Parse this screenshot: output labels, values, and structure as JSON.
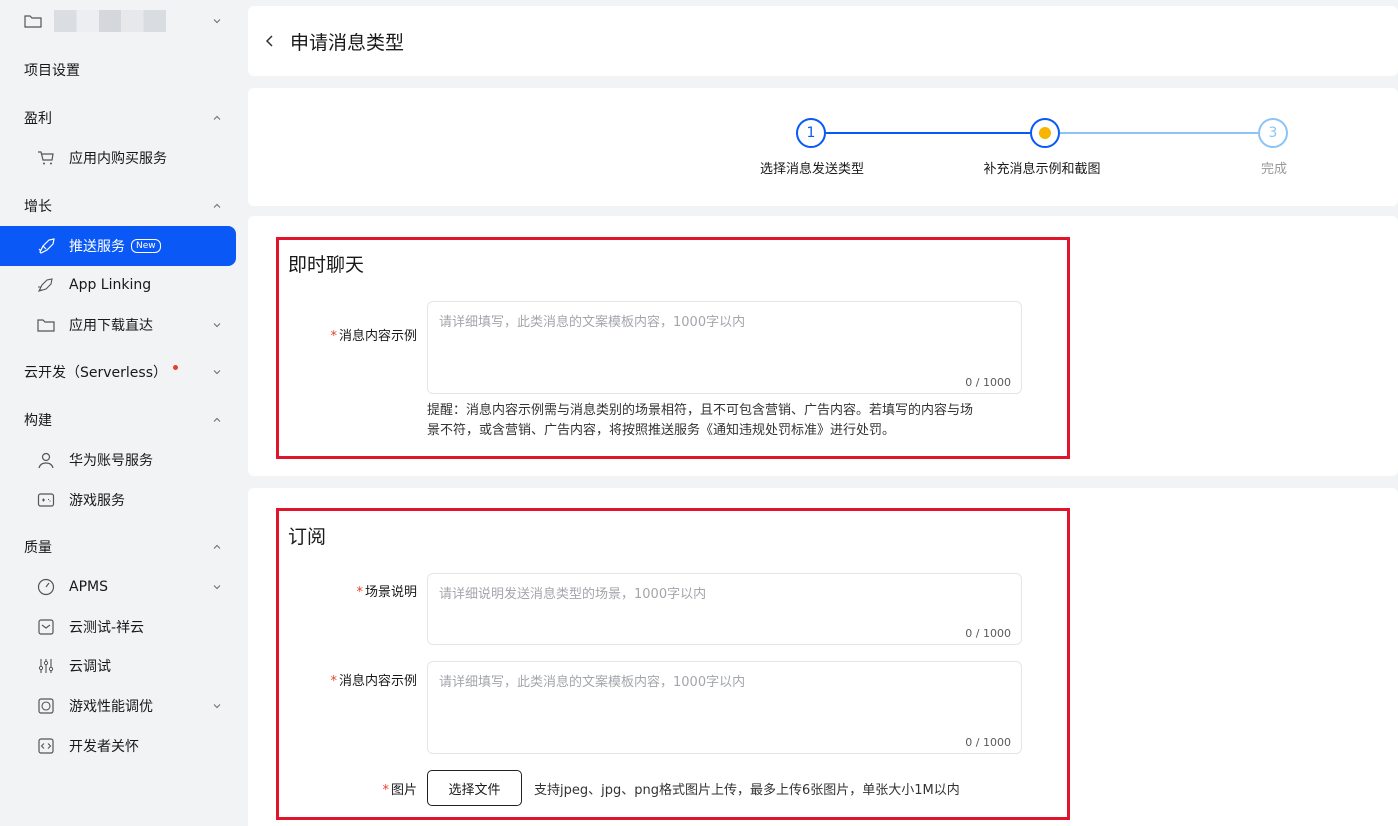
{
  "sidebar": {
    "project_name": "",
    "items": [
      {
        "label": "项目设置"
      },
      {
        "label": "盈利"
      },
      {
        "label": "应用内购买服务"
      },
      {
        "label": "增长"
      },
      {
        "label": "推送服务",
        "badge": "New"
      },
      {
        "label": "App Linking"
      },
      {
        "label": "应用下载直达"
      },
      {
        "label": "云开发（Serverless）"
      },
      {
        "label": "构建"
      },
      {
        "label": "华为账号服务"
      },
      {
        "label": "游戏服务"
      },
      {
        "label": "质量"
      },
      {
        "label": "APMS"
      },
      {
        "label": "云测试-祥云"
      },
      {
        "label": "云调试"
      },
      {
        "label": "游戏性能调优"
      },
      {
        "label": "开发者关怀"
      }
    ]
  },
  "header": {
    "title": "申请消息类型"
  },
  "steps": [
    {
      "number": "1",
      "label": "选择消息发送类型",
      "state": "done"
    },
    {
      "number": "",
      "label": "补充消息示例和截图",
      "state": "current"
    },
    {
      "number": "3",
      "label": "完成",
      "state": "pending"
    }
  ],
  "section_chat": {
    "title": "即时聊天",
    "field_label": "消息内容示例",
    "placeholder": "请详细填写，此类消息的文案模板内容，1000字以内",
    "count": "0 / 1000",
    "hint_line1": "提醒：消息内容示例需与消息类别的场景相符，且不可包含营销、广告内容。若填写的内容与场",
    "hint_line2": "景不符，或含营销、广告内容，将按照推送服务《通知违规处罚标准》进行处罚。"
  },
  "section_subscribe": {
    "title": "订阅",
    "scene_label": "场景说明",
    "scene_placeholder": "请详细说明发送消息类型的场景，1000字以内",
    "scene_count": "0 / 1000",
    "content_label": "消息内容示例",
    "content_placeholder": "请详细填写，此类消息的文案模板内容，1000字以内",
    "content_count": "0 / 1000",
    "image_label": "图片",
    "file_button": "选择文件",
    "file_hint": "支持jpeg、jpg、png格式图片上传，最多上传6张图片，单张大小1M以内"
  },
  "colors": {
    "accent": "#0a59f7",
    "current_step": "#f7b500",
    "highlight_border": "#e0142a",
    "required": "#e84026"
  }
}
